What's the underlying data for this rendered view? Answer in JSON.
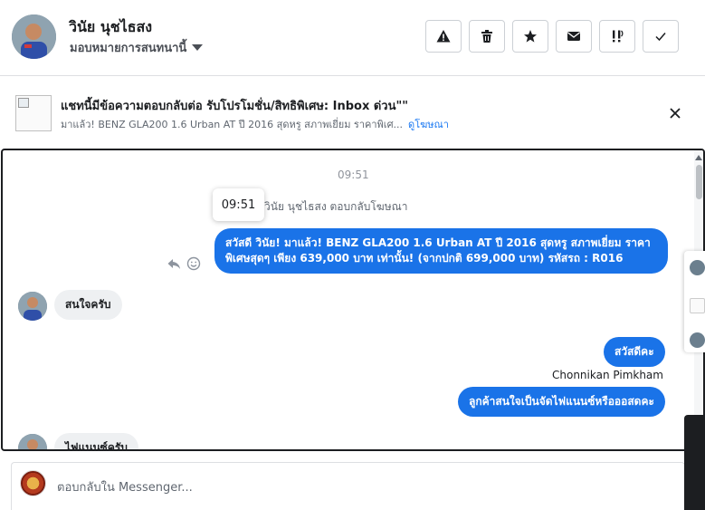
{
  "header": {
    "user_name": "วินัย นุชไธสง",
    "assign_label": "มอบหมายการสนทนานี้",
    "toolbar": [
      {
        "icon": "warning-icon",
        "name": "spam-button"
      },
      {
        "icon": "trash-icon",
        "name": "delete-button"
      },
      {
        "icon": "star-icon",
        "name": "star-button"
      },
      {
        "icon": "envelope-icon",
        "name": "mark-unread-button"
      },
      {
        "icon": "follow-up-icon",
        "name": "follow-up-button"
      },
      {
        "icon": "check-icon",
        "name": "done-button"
      }
    ]
  },
  "banner": {
    "title": "แชทนี้มีข้อความตอบกลับต่อ รับโปรโมชั่น/สิทธิพิเศษ: Inbox ด่วน\"\"",
    "subtitle": "มาแล้ว! BENZ GLA200 1.6 Urban AT ปี 2016 สุดหรู สภาพเยี่ยม ราคาพิเศ...",
    "link": "ดูโฆษณา"
  },
  "chat": {
    "top_time": "09:51",
    "tooltip_time": "09:51",
    "reply_note": "วินัย นุชไธสง ตอบกลับโฆษณา",
    "messages": [
      {
        "text": "สวัสดี วินัย! มาแล้ว! BENZ GLA200 1.6 Urban AT ปี 2016 สุดหรู สภาพเยี่ยม ราคาพิเศษสุดๆ เพียง 639,000 บาท เท่านั้น! (จากปกติ 699,000 บาท) รหัสรถ : R016"
      },
      {
        "text": "สนใจครับ"
      },
      {
        "text": "สวัสดีคะ"
      },
      {
        "text": "ลูกค้าสนใจเป็นจัดไฟแนนซ์หรือออสดคะ"
      },
      {
        "text": "ไฟแนนซ์ครับ"
      }
    ],
    "sender_name": "Chonnikan Pimkham"
  },
  "composer": {
    "placeholder": "ตอบกลับใน Messenger..."
  },
  "colors": {
    "accent": "#1a73e8",
    "incoming": "#eef0f2"
  }
}
